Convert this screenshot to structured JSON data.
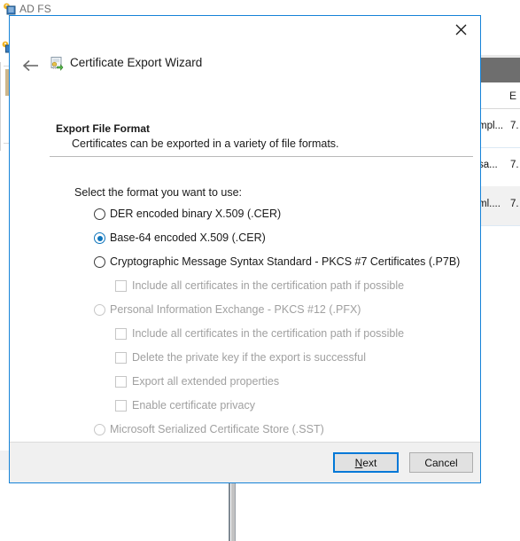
{
  "background": {
    "window_title": "AD FS",
    "title_icon": "adfs-icon",
    "list": {
      "column_header": "E",
      "rows": [
        {
          "name": "mpl...",
          "value": "7."
        },
        {
          "name": "sa...",
          "value": "7."
        },
        {
          "name": "ml....",
          "value": "7."
        }
      ]
    }
  },
  "wizard": {
    "title": "Certificate Export Wizard",
    "title_icon": "certificate-export-icon",
    "back_icon": "back-arrow-icon",
    "close_icon": "close-icon",
    "page": {
      "heading": "Export File Format",
      "subheading": "Certificates can be exported in a variety of file formats.",
      "prompt": "Select the format you want to use:"
    },
    "options": [
      {
        "id": "der",
        "type": "radio",
        "label": "DER encoded binary X.509 (.CER)",
        "checked": false,
        "disabled": false,
        "indent": false
      },
      {
        "id": "base64",
        "type": "radio",
        "label": "Base-64 encoded X.509 (.CER)",
        "checked": true,
        "disabled": false,
        "indent": false
      },
      {
        "id": "pkcs7",
        "type": "radio",
        "label": "Cryptographic Message Syntax Standard - PKCS #7 Certificates (.P7B)",
        "checked": false,
        "disabled": false,
        "indent": false
      },
      {
        "id": "pkcs7-include-all",
        "type": "checkbox",
        "label": "Include all certificates in the certification path if possible",
        "checked": false,
        "disabled": true,
        "indent": true
      },
      {
        "id": "pfx",
        "type": "radio",
        "label": "Personal Information Exchange - PKCS #12 (.PFX)",
        "checked": false,
        "disabled": true,
        "indent": false
      },
      {
        "id": "pfx-include-all",
        "type": "checkbox",
        "label": "Include all certificates in the certification path if possible",
        "checked": false,
        "disabled": true,
        "indent": true
      },
      {
        "id": "pfx-delete-key",
        "type": "checkbox",
        "label": "Delete the private key if the export is successful",
        "checked": false,
        "disabled": true,
        "indent": true
      },
      {
        "id": "pfx-export-extended",
        "type": "checkbox",
        "label": "Export all extended properties",
        "checked": false,
        "disabled": true,
        "indent": true
      },
      {
        "id": "pfx-enable-privacy",
        "type": "checkbox",
        "label": "Enable certificate privacy",
        "checked": false,
        "disabled": true,
        "indent": true
      },
      {
        "id": "sst",
        "type": "radio",
        "label": "Microsoft Serialized Certificate Store (.SST)",
        "checked": false,
        "disabled": true,
        "indent": false
      }
    ],
    "footer": {
      "next_label": "Next",
      "next_accelerator": "N",
      "cancel_label": "Cancel"
    }
  },
  "colors": {
    "accent_blue": "#0078d7",
    "dialog_border": "#1683d8",
    "radio_checked": "#0f75bc",
    "disabled_text": "#a0a0a0",
    "footer_bg": "#f0f0f0"
  }
}
